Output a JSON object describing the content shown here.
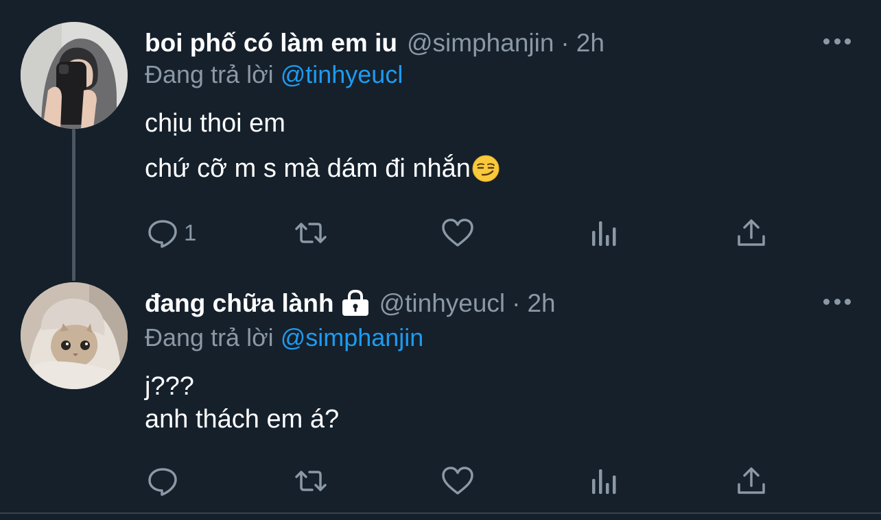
{
  "tweets": [
    {
      "name": "boi phố có làm em iu",
      "handle": "@simphanjin",
      "separator": "·",
      "time": "2h",
      "reply_prefix": "Đang trả lời",
      "reply_to": "@tinhyeucl",
      "lines": [
        "chịu thoi em",
        "chứ cỡ m s mà dám đi nhắn"
      ],
      "emoji": "smirking-face-emoji",
      "reply_count": "1",
      "retweet_count": "",
      "like_count": ""
    },
    {
      "name": "đang chữa lành",
      "handle": "@tinhyeucl",
      "separator": "·",
      "time": "2h",
      "protected": true,
      "reply_prefix": "Đang trả lời",
      "reply_to": "@simphanjin",
      "lines": [
        "j???",
        "anh thách em á?"
      ],
      "reply_count": "",
      "retweet_count": "",
      "like_count": ""
    }
  ],
  "colors": {
    "background": "#15202b",
    "text": "#ffffff",
    "secondary": "#8b98a5",
    "link": "#1d9bf0",
    "divider": "#38444d"
  },
  "icons": [
    "more-icon",
    "reply-icon",
    "retweet-icon",
    "like-icon",
    "views-icon",
    "share-icon",
    "lock-icon"
  ]
}
